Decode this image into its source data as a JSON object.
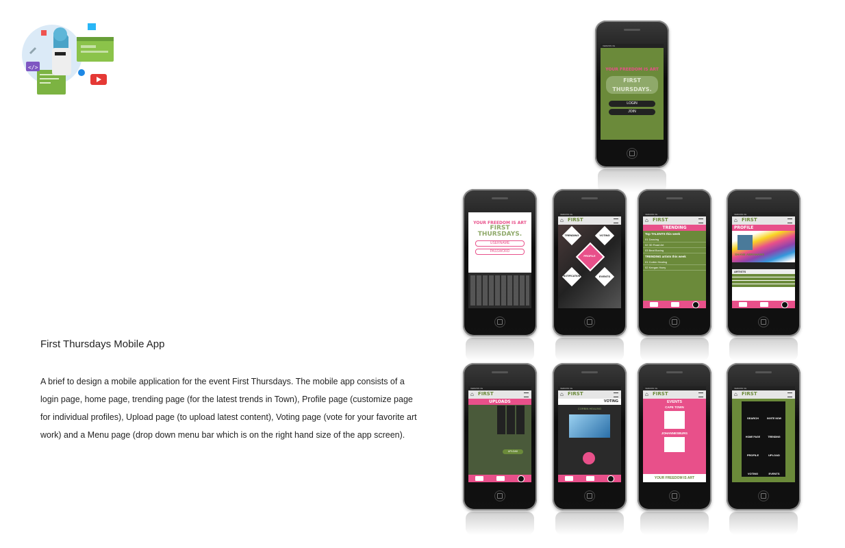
{
  "project": {
    "title": "First Thursdays Mobile App",
    "description": "A brief to design a mobile application for the event First Thursdays. The mobile app consists of a login page, home page, trending page (for the latest trends in Town), Profile page (customize page for individual profiles), Upload page (to upload latest content), Voting page (vote for your favorite art work) and a Menu page (drop down menu bar which is on the right hand size of the app screen)."
  },
  "colors": {
    "green": "#6b8a3a",
    "pink": "#e8508a",
    "black": "#111111",
    "grey": "#e6e6e6"
  },
  "brand": {
    "tagline": "YOUR FREEDOM IS ART",
    "logo": "FIRST THURSDAYS.",
    "logo_short": "FIRST"
  },
  "login": {
    "login_label": "LOGIN",
    "join_label": "JOIN",
    "username": "USERNAME",
    "password": "PASSWORD"
  },
  "home": {
    "trending": "TRENDING",
    "voting": "VOTING",
    "profile": "PROFILE",
    "notification": "NOTIFICATION",
    "events": "EVENTS"
  },
  "trending": {
    "title": "TRENDING",
    "talents_heading": "Top TALENTS this week",
    "talents": [
      {
        "rank": "01",
        "name": "Dancing"
      },
      {
        "rank": "02",
        "name": "3D Road Art"
      },
      {
        "rank": "03",
        "name": "Beat Boxing"
      }
    ],
    "artists_heading": "TRENDING artists this week",
    "artists": [
      {
        "rank": "01",
        "name": "Corbin Healing"
      },
      {
        "rank": "02",
        "name": "Keegan Harry"
      }
    ]
  },
  "profile": {
    "title": "PROFILE",
    "name": "SHANE ABRAHAMS",
    "section": "ARTISTS"
  },
  "uploads": {
    "title": "UPLOADS",
    "upload_button": "UPLOAD"
  },
  "voting": {
    "title": "VOTING",
    "artist": "CORBIN HEALING"
  },
  "events": {
    "title": "EVENTS",
    "city1": "CAPE TOWN",
    "city2": "JOHANNESBURG"
  },
  "menu": {
    "items": [
      "SEARCH",
      "INVITE NOW",
      "HOME PAGE",
      "TRENDING",
      "PROFILE",
      "UPLOAD",
      "VOTING",
      "EVENTS"
    ]
  }
}
